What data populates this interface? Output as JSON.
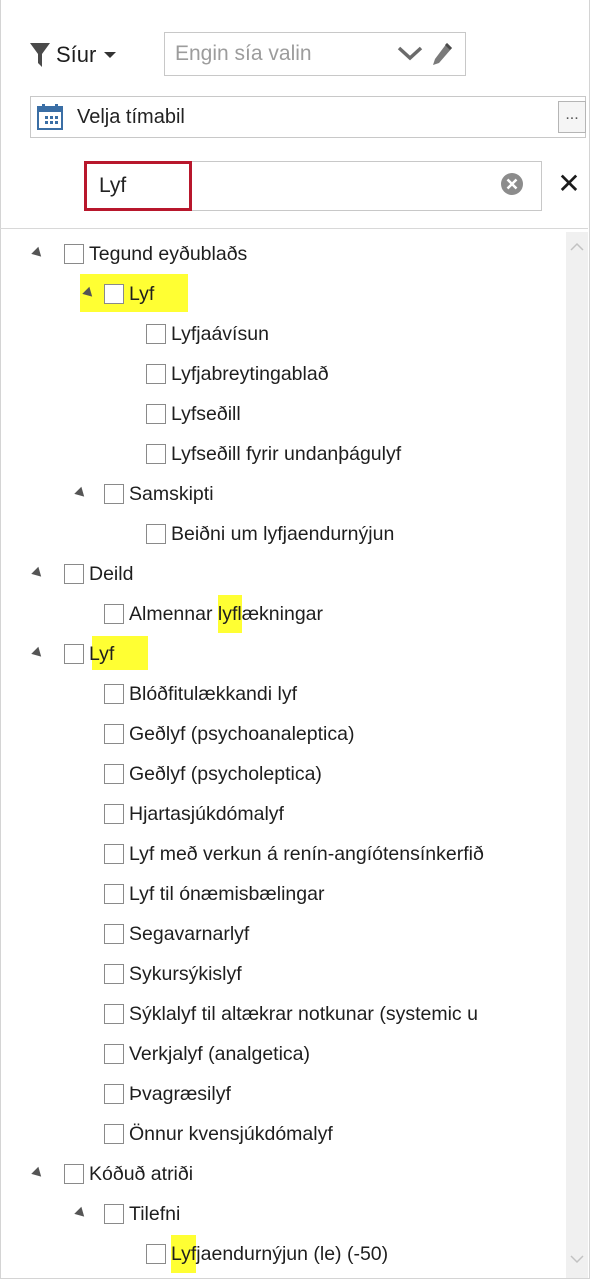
{
  "filter": {
    "button_label": "Síur",
    "select_placeholder": "Engin sía valin"
  },
  "period": {
    "label": "Velja tímabil",
    "more_label": "..."
  },
  "search": {
    "value": "Lyf",
    "clear_icon": "clear-circle-icon",
    "close_label": "✕"
  },
  "colors": {
    "highlight": "#ffff33",
    "focus_border": "#b8172c"
  },
  "tree": {
    "nodes": [
      {
        "label": "Tegund eyðublaðs",
        "expanded": true,
        "level": 0
      },
      {
        "label": "Lyf",
        "expanded": true,
        "level": 1,
        "highlighted": true
      },
      {
        "label": "Lyfjaávísun",
        "level": 2
      },
      {
        "label": "Lyfjabreytingablað",
        "level": 2
      },
      {
        "label": "Lyfseðill",
        "level": 2
      },
      {
        "label": "Lyfseðill fyrir undanþágulyf",
        "level": 2
      },
      {
        "label": "Samskipti",
        "expanded": true,
        "level": 1
      },
      {
        "label": "Beiðni um lyfjaendurnýjun",
        "level": 2
      },
      {
        "label": "Deild",
        "expanded": true,
        "level": 0
      },
      {
        "label_pre": "Almennar ",
        "label_hl": "lyfl",
        "label_post": "ækningar",
        "level": 1
      },
      {
        "label": "Lyf",
        "expanded": true,
        "level": 0,
        "highlighted": true
      },
      {
        "label": "Blóðfitulækkandi lyf",
        "level": 1
      },
      {
        "label": "Geðlyf (psychoanaleptica)",
        "level": 1
      },
      {
        "label": "Geðlyf (psycholeptica)",
        "level": 1
      },
      {
        "label": "Hjartasjúkdómalyf",
        "level": 1
      },
      {
        "label": "Lyf með verkun á renín-angíótensínkerfið",
        "level": 1
      },
      {
        "label": "Lyf til ónæmisbælingar",
        "level": 1
      },
      {
        "label": "Segavarnarlyf",
        "level": 1
      },
      {
        "label": "Sykursýkislyf",
        "level": 1
      },
      {
        "label": "Sýklalyf til altækrar notkunar (systemic u",
        "level": 1
      },
      {
        "label": "Verkjalyf (analgetica)",
        "level": 1
      },
      {
        "label": "Þvagræsilyf",
        "level": 1
      },
      {
        "label": "Önnur kvensjúkdómalyf",
        "level": 1
      },
      {
        "label": "Kóðuð atriði",
        "expanded": true,
        "level": 0
      },
      {
        "label": "Tilefni",
        "expanded": true,
        "level": 1
      },
      {
        "label_hl": "Lyf",
        "label_post": "jaendurnýjun (le) (-50)",
        "level": 2
      }
    ]
  }
}
